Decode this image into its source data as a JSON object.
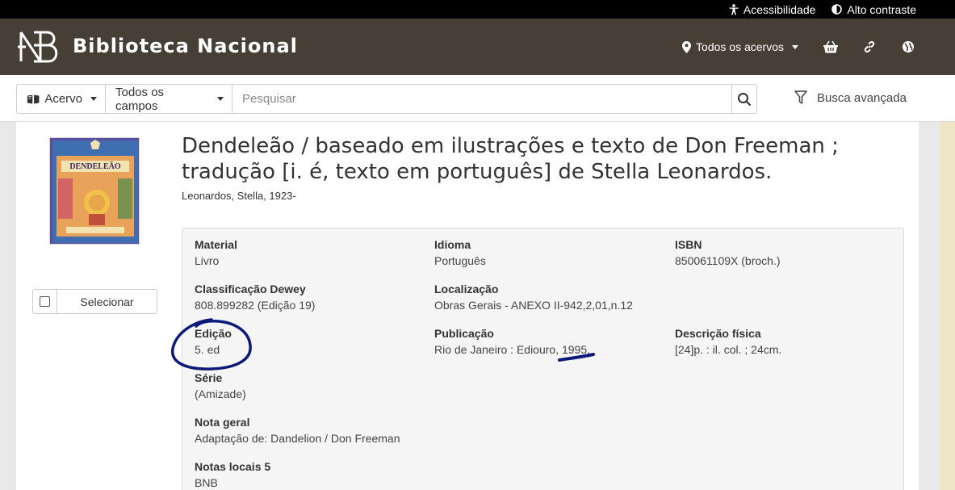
{
  "accessibility_bar": {
    "accessibility_label": "Acessibilidade",
    "contrast_label": "Alto contraste"
  },
  "header": {
    "brand": "Biblioteca Nacional",
    "collections_dropdown": "Todos os acervos",
    "icons": [
      "map-marker-icon",
      "basket-icon",
      "link-icon",
      "globe-icon"
    ]
  },
  "search": {
    "collection_select": "Acervo",
    "field_select": "Todos os campos",
    "placeholder": "Pesquisar",
    "advanced_label": "Busca avançada"
  },
  "record": {
    "title_line1": "Dendeleão / baseado em ilustrações e texto de Don Freeman ;",
    "title_line2": "tradução [i. é, texto em português] de Stella Leonardos.",
    "author": "Leonardos, Stella, 1923-",
    "select_label": "Selecionar",
    "cover_title": "DENDELEÃO",
    "fields": {
      "material": {
        "label": "Material",
        "value": "Livro"
      },
      "idioma": {
        "label": "Idioma",
        "value": "Português"
      },
      "isbn": {
        "label": "ISBN",
        "value": "850061109X (broch.)"
      },
      "dewey": {
        "label": "Classificação Dewey",
        "value": "808.899282 (Edição 19)"
      },
      "localizacao": {
        "label": "Localização",
        "value": "Obras Gerais - ANEXO II-942,2,01,n.12"
      },
      "edicao": {
        "label": "Edição",
        "value": "5. ed"
      },
      "publicacao": {
        "label": "Publicação",
        "value": "Rio de Janeiro : Ediouro, 1995."
      },
      "descricao": {
        "label": "Descrição física",
        "value": "[24]p. : il. col. ; 24cm."
      },
      "serie": {
        "label": "Série",
        "value": "(Amizade)"
      },
      "nota_geral": {
        "label": "Nota geral",
        "value": "Adaptação de: Dandelion / Don Freeman"
      },
      "notas_locais": {
        "label": "Notas locais 5",
        "value": "BNB"
      }
    }
  },
  "colors": {
    "header_bg": "#453f35",
    "annotation_ink": "#0d1a7a"
  }
}
